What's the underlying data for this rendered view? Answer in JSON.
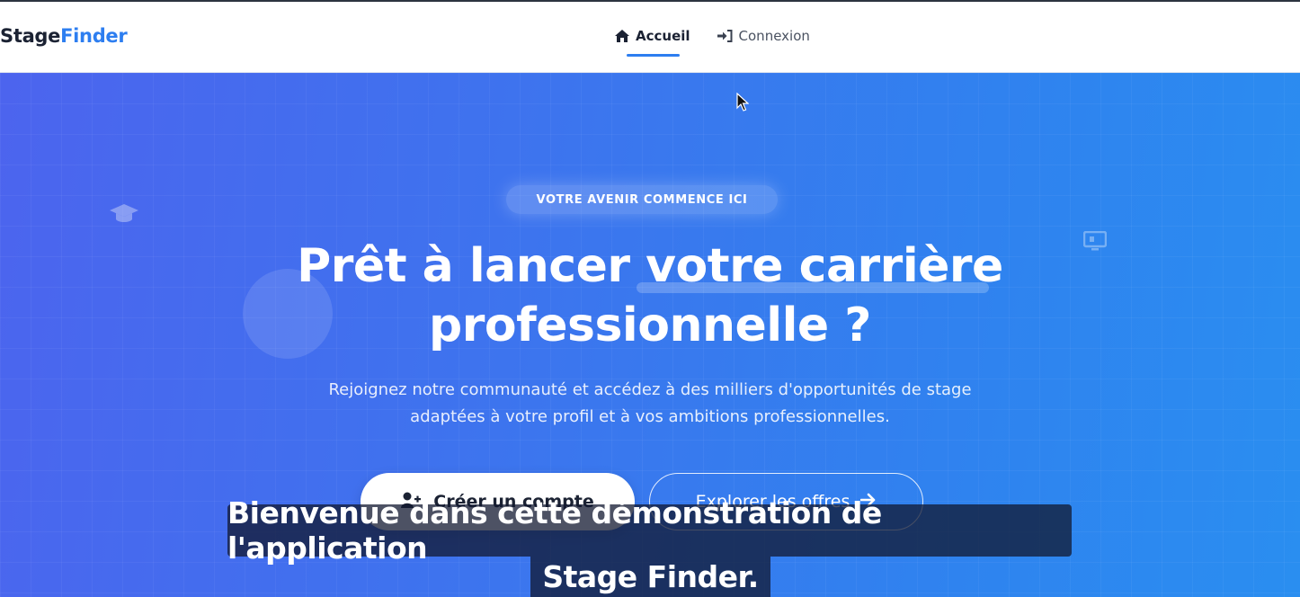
{
  "logo": {
    "part1": "Stage",
    "part2": "Finder"
  },
  "nav": {
    "home_label": "Accueil",
    "login_label": "Connexion"
  },
  "hero": {
    "badge": "VOTRE AVENIR COMMENCE ICI",
    "title_line1_a": "Prêt à lancer ",
    "title_line1_b": "votre carrière",
    "title_line2": "professionnelle ?",
    "subtitle_line1": "Rejoignez notre communauté et accédez à des milliers d'opportunités de stage",
    "subtitle_line2": "adaptées à votre profil et à vos ambitions professionnelles.",
    "primary_button": "Créer un compte",
    "secondary_button": "Explorer les offres"
  },
  "captions": {
    "line1": "Bienvenue dans cette démonstration de l'application",
    "line2": "Stage Finder."
  },
  "colors": {
    "accent": "#2d7ef0",
    "hero_start": "#4c64ee",
    "hero_end": "#2a8ef0",
    "text_dark": "#1b2233"
  },
  "icons": [
    "home-icon",
    "sign-in-icon",
    "graduation-cap-icon",
    "screen-icon",
    "user-plus-icon",
    "arrow-right-icon",
    "mouse-cursor-icon"
  ]
}
